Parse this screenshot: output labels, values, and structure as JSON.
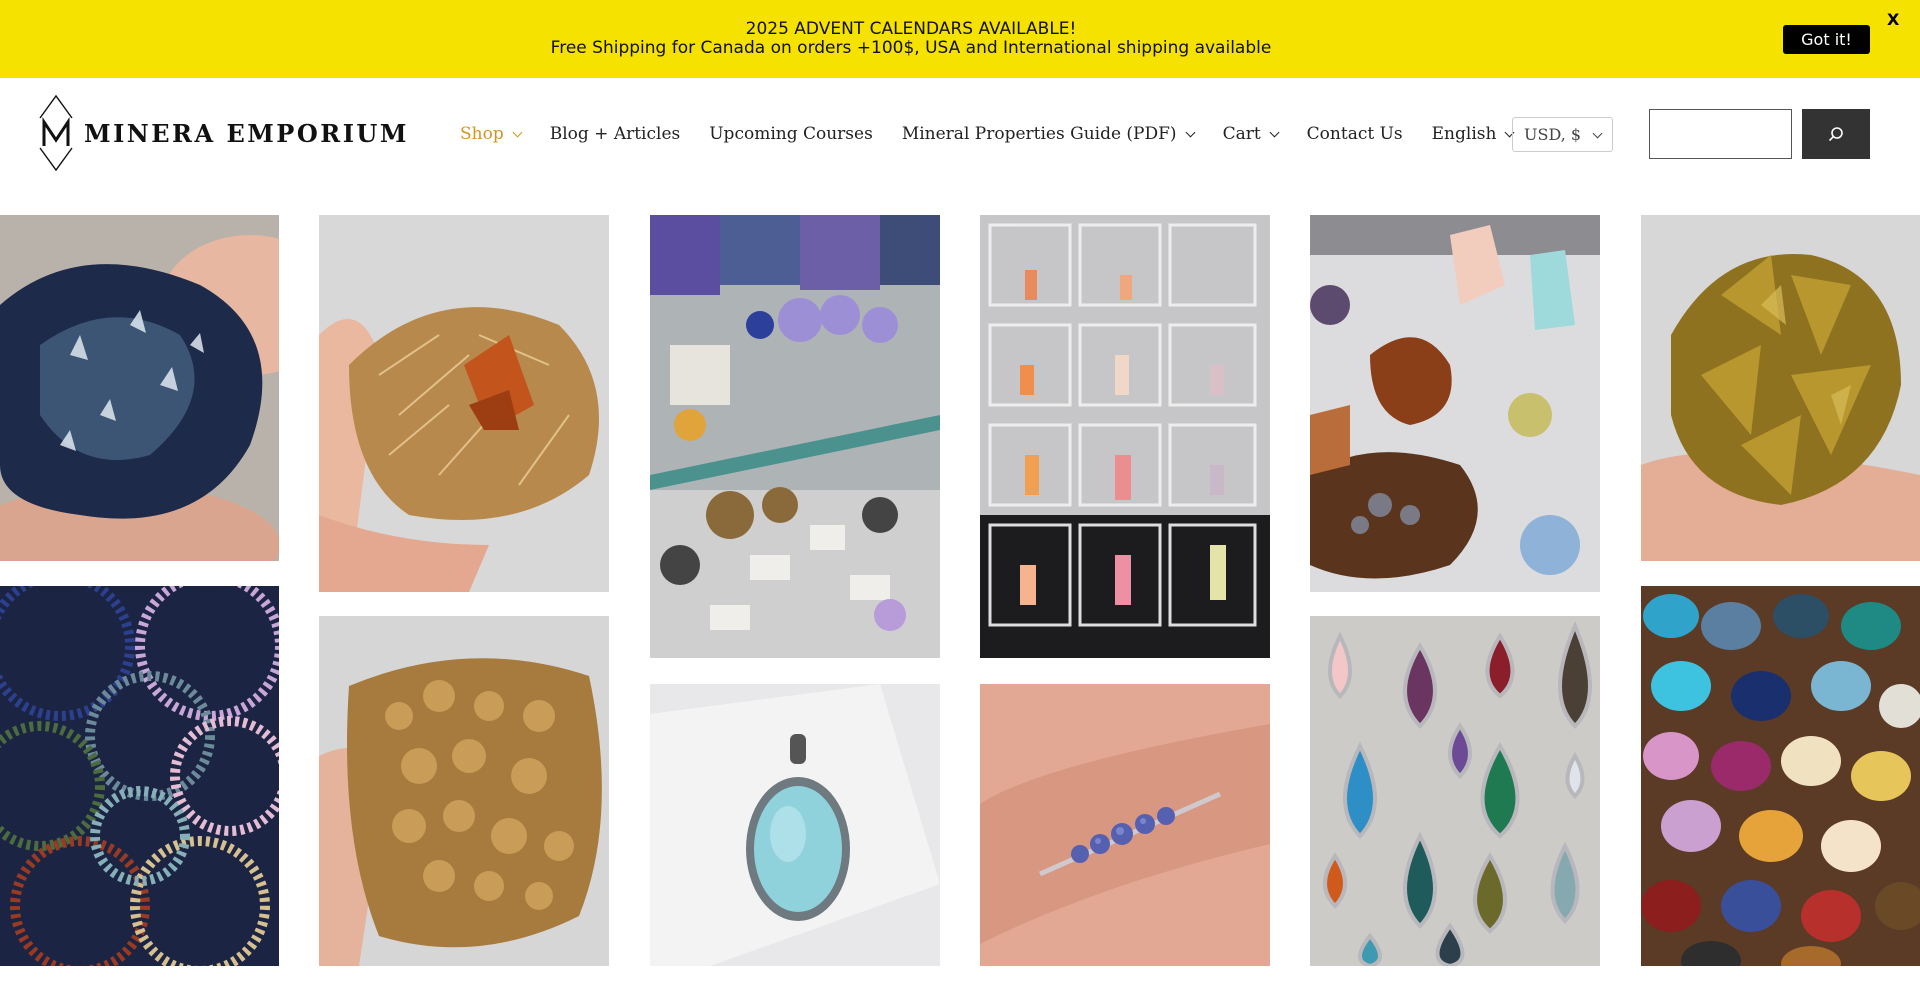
{
  "announcement": {
    "line1": "2025 ADVENT CALENDARS AVAILABLE!",
    "line2": "Free Shipping for Canada on orders +100$, USA and International shipping available",
    "got_it": "Got it!",
    "close": "X",
    "background": "#f5e200"
  },
  "brand": {
    "name": "MINERA EMPORIUM"
  },
  "nav": [
    {
      "label": "Shop"
    },
    {
      "label": "Blog + Articles"
    },
    {
      "label": "Upcoming Courses"
    },
    {
      "label": "Mineral Properties Guide (PDF)"
    },
    {
      "label": "Cart"
    },
    {
      "label": "Contact Us"
    },
    {
      "label": "English"
    }
  ],
  "accent_color": "#d3951d",
  "currency": {
    "selected": "USD, $"
  },
  "search": {
    "placeholder": "",
    "button_icon": "search-icon"
  },
  "gallery": [
    {
      "name": "blue-crystal-cluster-photo"
    },
    {
      "name": "golden-mica-crystal-photo"
    },
    {
      "name": "mineral-display-cabinet-photo"
    },
    {
      "name": "crystals-in-acrylic-boxes-photo"
    },
    {
      "name": "crystal-specimens-on-stands-photo"
    },
    {
      "name": "yellow-calcite-cluster-photo"
    },
    {
      "name": "beaded-bracelets-photo"
    },
    {
      "name": "brown-botryoidal-mineral-photo"
    },
    {
      "name": "aquamarine-pendant-photo"
    },
    {
      "name": "tanzanite-ring-photo"
    },
    {
      "name": "gemstone-pendants-photo"
    },
    {
      "name": "tumbled-stones-photo"
    }
  ]
}
